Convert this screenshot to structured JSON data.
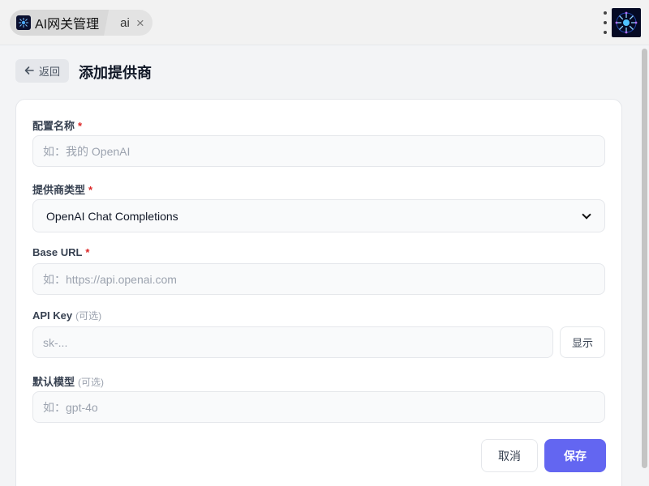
{
  "tabs": {
    "main_label": "AI网关管理",
    "sub_label": "ai",
    "close_symbol": "×"
  },
  "header": {
    "back_label": "返回",
    "back_icon": "arrow-left-icon",
    "title": "添加提供商"
  },
  "form": {
    "name": {
      "label": "配置名称",
      "required_mark": "*",
      "placeholder": "如：我的 OpenAI",
      "value": ""
    },
    "provider_type": {
      "label": "提供商类型",
      "required_mark": "*",
      "selected": "OpenAI Chat Completions"
    },
    "base_url": {
      "label": "Base URL",
      "required_mark": "*",
      "placeholder": "如：https://api.openai.com",
      "value": ""
    },
    "api_key": {
      "label": "API Key",
      "optional_note": "(可选)",
      "placeholder": "sk-...",
      "value": "",
      "toggle_label": "显示"
    },
    "default_model": {
      "label": "默认模型",
      "optional_note": "(可选)",
      "placeholder": "如：gpt-4o",
      "value": ""
    }
  },
  "actions": {
    "cancel_label": "取消",
    "save_label": "保存"
  },
  "colors": {
    "accent": "#6366f1",
    "required": "#dc2626",
    "app_logo_bg": "#050a24"
  }
}
